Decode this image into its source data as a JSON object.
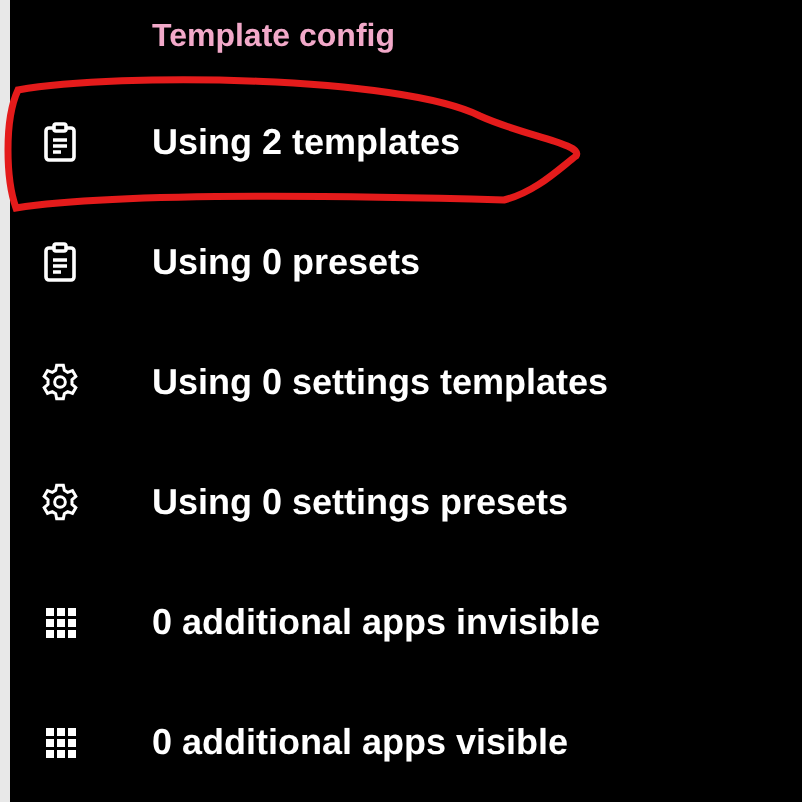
{
  "section_title": "Template config",
  "items": [
    {
      "kind": "clipboard",
      "label": "Using 2 templates",
      "circled": true
    },
    {
      "kind": "clipboard",
      "label": "Using 0 presets",
      "circled": false
    },
    {
      "kind": "gear",
      "label": "Using 0 settings templates",
      "circled": false
    },
    {
      "kind": "gear",
      "label": "Using 0 settings presets",
      "circled": false
    },
    {
      "kind": "grid",
      "label": "0 additional apps invisible",
      "circled": false
    },
    {
      "kind": "grid",
      "label": "0 additional apps visible",
      "circled": false
    }
  ]
}
